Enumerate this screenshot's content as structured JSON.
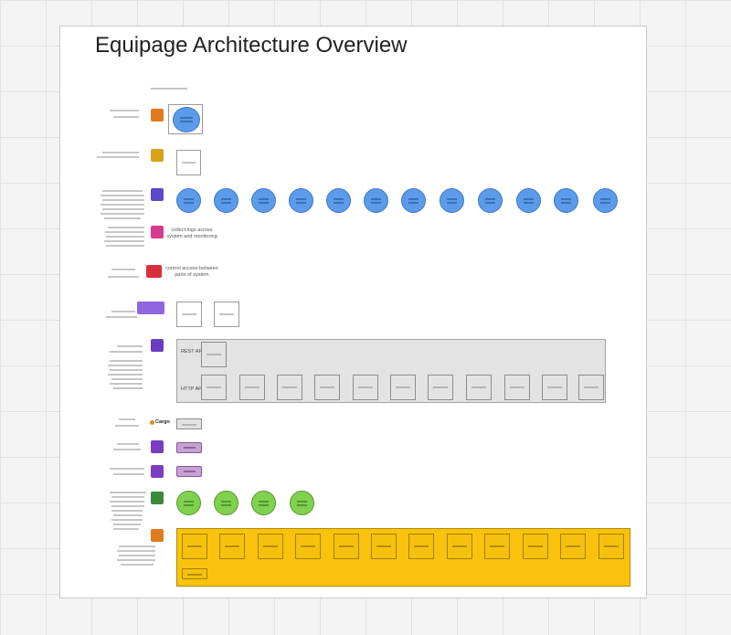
{
  "page": {
    "title": "Equipage Architecture Overview"
  },
  "annotations": {
    "logs": "collect logs across system and monitoring",
    "access": "control access between parts of system"
  },
  "api_gateway": {
    "rest_label": "REST API",
    "http_label": "HTTP API"
  },
  "cargo_logo": "Cargo",
  "colors": {
    "compute": "#5b9bea",
    "storage": "#7fd14f",
    "queue": "#f6c10c",
    "event": "#c9a0d6",
    "gateway_panel": "#e3e3e3",
    "board": "#ffffff",
    "canvas": "#f4f4f4"
  },
  "row_icons": [
    {
      "row": 1,
      "icon": "lambda-icon",
      "color": "#e07a1f"
    },
    {
      "row": 2,
      "icon": "s3-bucket-icon",
      "color": "#d9a21a"
    },
    {
      "row": 3,
      "icon": "ecs-cluster-icon",
      "color": "#5a49c8"
    },
    {
      "row": 4,
      "icon": "cloudwatch-icon",
      "color": "#d63a8e"
    },
    {
      "row": 5,
      "icon": "iam-icon",
      "color": "#d6303a"
    },
    {
      "row": 6,
      "icon": "cognito-icon",
      "color": "#8f66e0"
    },
    {
      "row": 7,
      "icon": "api-gateway-icon",
      "color": "#6a3cc0"
    },
    {
      "row": 8,
      "icon": "cargo-logo-icon",
      "color": "#e08a1f"
    },
    {
      "row": 9,
      "icon": "eventbridge-icon",
      "color": "#7b3cc0"
    },
    {
      "row": 10,
      "icon": "eventbridge-icon",
      "color": "#7b3cc0"
    },
    {
      "row": 11,
      "icon": "dynamodb-icon",
      "color": "#3a8a3a"
    },
    {
      "row": 12,
      "icon": "sqs-icon",
      "color": "#e07a1f"
    }
  ]
}
